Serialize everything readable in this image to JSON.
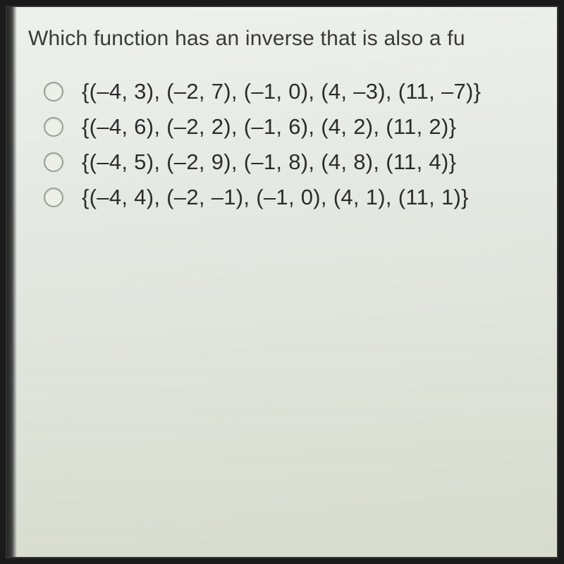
{
  "question": "Which function has an inverse that is also a fu",
  "options": [
    "{(–4, 3), (–2, 7), (–1, 0), (4, –3), (11, –7)}",
    "{(–4, 6), (–2, 2), (–1, 6), (4, 2), (11, 2)}",
    "{(–4, 5), (–2, 9), (–1, 8), (4, 8), (11, 4)}",
    "{(–4, 4), (–2, –1), (–1, 0), (4, 1), (11, 1)}"
  ]
}
